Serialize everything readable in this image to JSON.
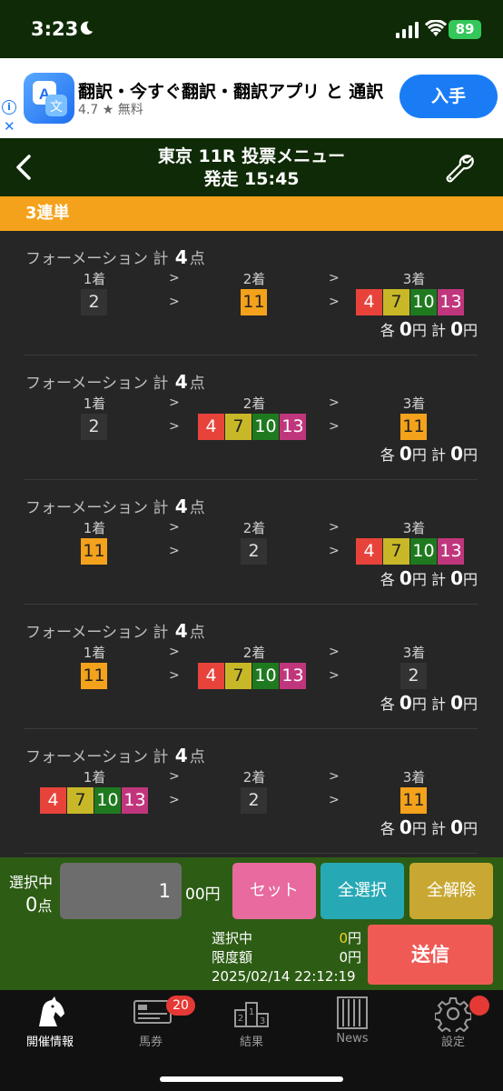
{
  "status": {
    "time": "3:23",
    "battery": "89"
  },
  "ad": {
    "title": "翻訳・今すぐ翻訳・翻訳アプリ と 通訳",
    "rating": "4.7 ★ 無料",
    "button": "入手"
  },
  "header": {
    "title": "東京 11R 投票メニュー",
    "subtitle": "発走 15:45"
  },
  "bet_type": "3連単",
  "formation": {
    "prefix": "フォーメーション 計",
    "suffix": "点",
    "labels": [
      "1着",
      "2着",
      "3着"
    ],
    "arrow": ">",
    "each": "各",
    "yen": "円",
    "total": "計"
  },
  "entries": [
    {
      "count": "4",
      "first": [
        {
          "n": "2",
          "c": "dark"
        }
      ],
      "second": [
        {
          "n": "11",
          "c": "orange"
        }
      ],
      "third": [
        {
          "n": "4",
          "c": "red"
        },
        {
          "n": "7",
          "c": "yellow"
        },
        {
          "n": "10",
          "c": "green"
        },
        {
          "n": "13",
          "c": "pink"
        }
      ],
      "each_amount": "0",
      "total_amount": "0"
    },
    {
      "count": "4",
      "first": [
        {
          "n": "2",
          "c": "dark"
        }
      ],
      "second": [
        {
          "n": "4",
          "c": "red"
        },
        {
          "n": "7",
          "c": "yellow"
        },
        {
          "n": "10",
          "c": "green"
        },
        {
          "n": "13",
          "c": "pink"
        }
      ],
      "third": [
        {
          "n": "11",
          "c": "orange"
        }
      ],
      "each_amount": "0",
      "total_amount": "0"
    },
    {
      "count": "4",
      "first": [
        {
          "n": "11",
          "c": "orange"
        }
      ],
      "second": [
        {
          "n": "2",
          "c": "dark"
        }
      ],
      "third": [
        {
          "n": "4",
          "c": "red"
        },
        {
          "n": "7",
          "c": "yellow"
        },
        {
          "n": "10",
          "c": "green"
        },
        {
          "n": "13",
          "c": "pink"
        }
      ],
      "each_amount": "0",
      "total_amount": "0"
    },
    {
      "count": "4",
      "first": [
        {
          "n": "11",
          "c": "orange"
        }
      ],
      "second": [
        {
          "n": "4",
          "c": "red"
        },
        {
          "n": "7",
          "c": "yellow"
        },
        {
          "n": "10",
          "c": "green"
        },
        {
          "n": "13",
          "c": "pink"
        }
      ],
      "third": [
        {
          "n": "2",
          "c": "dark"
        }
      ],
      "each_amount": "0",
      "total_amount": "0"
    },
    {
      "count": "4",
      "first": [
        {
          "n": "4",
          "c": "red"
        },
        {
          "n": "7",
          "c": "yellow"
        },
        {
          "n": "10",
          "c": "green"
        },
        {
          "n": "13",
          "c": "pink"
        }
      ],
      "second": [
        {
          "n": "2",
          "c": "dark"
        }
      ],
      "third": [
        {
          "n": "11",
          "c": "orange"
        }
      ],
      "each_amount": "0",
      "total_amount": "0"
    }
  ],
  "panel": {
    "selecting_label": "選択中",
    "selected_count": "0",
    "count_unit": "点",
    "amount": "1",
    "amount_unit": "00円",
    "set_label": "セット",
    "select_all_label": "全選択",
    "clear_all_label": "全解除",
    "info_selecting": "選択中",
    "info_limit": "限度額",
    "datetime": "2025/02/14 22:12:19",
    "selecting_amount": "0",
    "limit_amount": "0",
    "yen": "円",
    "send_label": "送信"
  },
  "tabs": [
    {
      "label": "開催情報",
      "icon": "horse-head-icon"
    },
    {
      "label": "馬券",
      "icon": "ticket-icon",
      "badge": "20"
    },
    {
      "label": "結果",
      "icon": "podium-icon"
    },
    {
      "label": "News",
      "icon": "newspaper-icon"
    },
    {
      "label": "設定",
      "icon": "gear-icon"
    }
  ]
}
